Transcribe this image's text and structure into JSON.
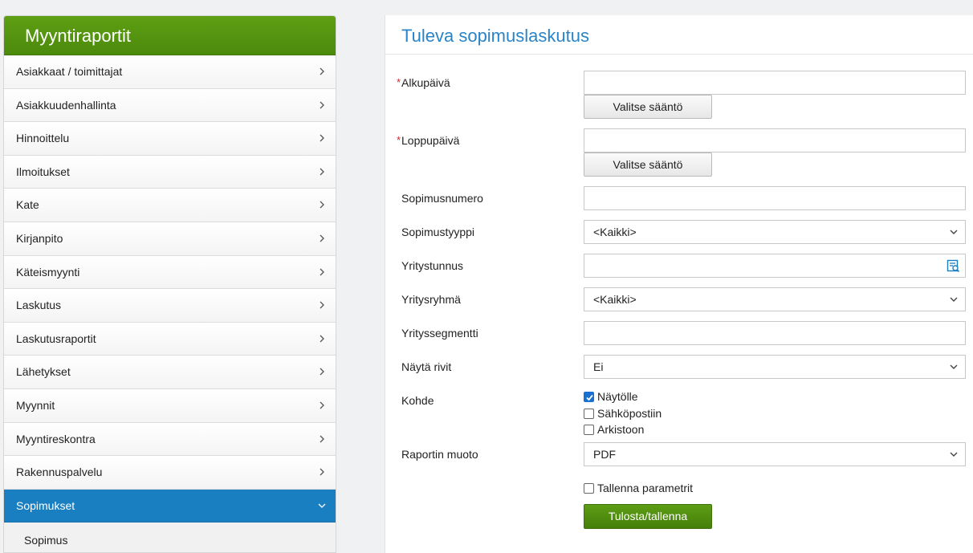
{
  "sidebar": {
    "title": "Myyntiraportit",
    "items": [
      {
        "label": "Asiakkaat / toimittajat"
      },
      {
        "label": "Asiakkuudenhallinta"
      },
      {
        "label": "Hinnoittelu"
      },
      {
        "label": "Ilmoitukset"
      },
      {
        "label": "Kate"
      },
      {
        "label": "Kirjanpito"
      },
      {
        "label": "Käteismyynti"
      },
      {
        "label": "Laskutus"
      },
      {
        "label": "Laskutusraportit"
      },
      {
        "label": "Lähetykset"
      },
      {
        "label": "Myynnit"
      },
      {
        "label": "Myyntireskontra"
      },
      {
        "label": "Rakennuspalvelu"
      },
      {
        "label": "Sopimukset"
      }
    ],
    "active_item": "Sopimukset",
    "subitems": [
      {
        "label": "Sopimus"
      }
    ],
    "icons": {
      "collapsed": "chevron-right-icon",
      "expanded": "chevron-down-icon"
    }
  },
  "form": {
    "title": "Tuleva sopimuslaskutus",
    "required_marker": "*",
    "start_date": {
      "label": "Alkupäivä",
      "value": "",
      "rule_button": "Valitse sääntö"
    },
    "end_date": {
      "label": "Loppupäivä",
      "value": "",
      "rule_button": "Valitse sääntö"
    },
    "contract_number": {
      "label": "Sopimusnumero",
      "value": ""
    },
    "contract_type": {
      "label": "Sopimustyyppi",
      "value": "<Kaikki>"
    },
    "company_id": {
      "label": "Yritystunnus",
      "value": "",
      "icon": "lookup-icon"
    },
    "company_group": {
      "label": "Yritysryhmä",
      "value": "<Kaikki>"
    },
    "company_segment": {
      "label": "Yrityssegmentti",
      "value": ""
    },
    "show_rows": {
      "label": "Näytä rivit",
      "value": "Ei"
    },
    "target": {
      "label": "Kohde",
      "options": [
        {
          "label": "Näytölle",
          "checked": true
        },
        {
          "label": "Sähköpostiin",
          "checked": false
        },
        {
          "label": "Arkistoon",
          "checked": false
        }
      ]
    },
    "report_format": {
      "label": "Raportin muoto",
      "value": "PDF"
    },
    "save_params": {
      "label": "Tallenna parametrit",
      "checked": false
    },
    "submit_label": "Tulosta/tallenna"
  },
  "colors": {
    "header_green": "#4c8a0c",
    "active_blue": "#1a7fc1",
    "title_blue": "#2a84c6",
    "required_red": "#d0262c"
  }
}
